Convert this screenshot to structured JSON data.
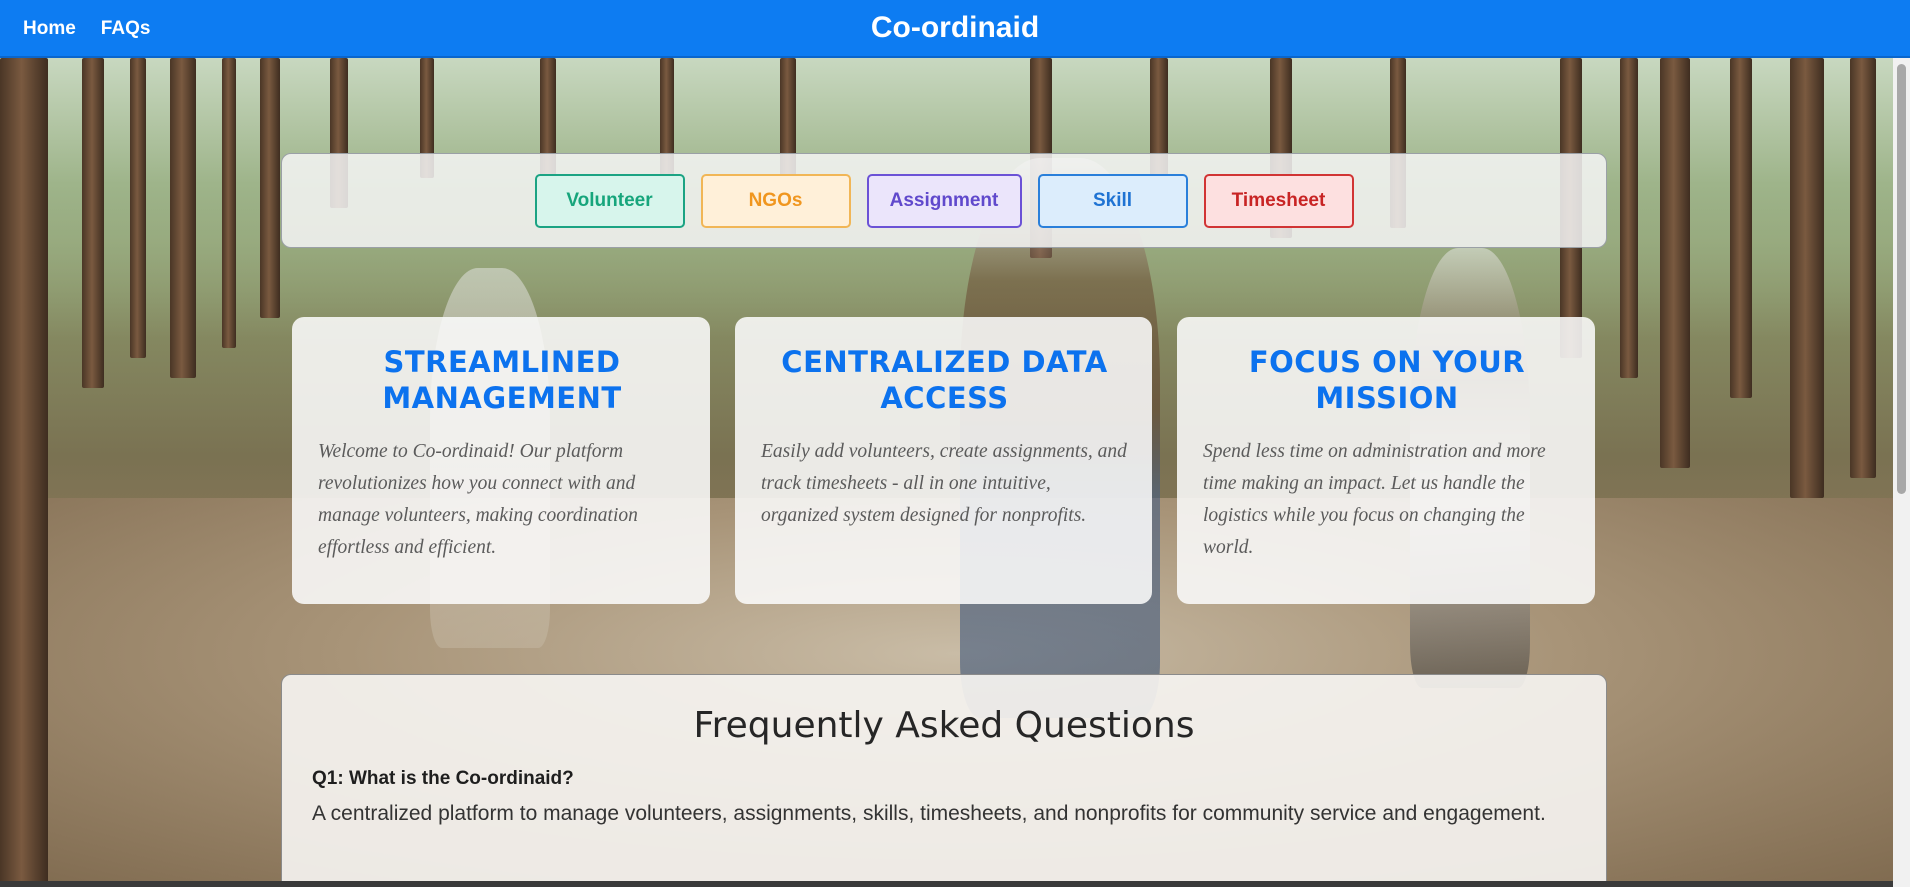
{
  "nav": {
    "brand": "Co-ordinaid",
    "links": [
      "Home",
      "FAQs"
    ]
  },
  "categories": [
    "Volunteer",
    "NGOs",
    "Assignment",
    "Skill",
    "Timesheet"
  ],
  "features": [
    {
      "title": "STREAMLINED MANAGEMENT",
      "text": "Welcome to Co-ordinaid! Our platform revolutionizes how you connect with and manage volunteers, making coordination effortless and efficient."
    },
    {
      "title": "CENTRALIZED DATA ACCESS",
      "text": "Easily add volunteers, create assignments, and track timesheets - all in one intuitive, organized system designed for nonprofits."
    },
    {
      "title": "FOCUS ON YOUR MISSION",
      "text": "Spend less time on administration and more time making an impact. Let us handle the logistics while you focus on changing the world."
    }
  ],
  "faq": {
    "heading": "Frequently Asked Questions",
    "items": [
      {
        "question": "Q1: What is the Co-ordinaid?",
        "answer": "A centralized platform to manage volunteers, assignments, skills, timesheets, and nonprofits for community service and engagement."
      }
    ]
  },
  "colors": {
    "navbar": "#0d7cf2",
    "card_title": "#0c72ee",
    "volunteer": "#17a57c",
    "ngos": "#f0961f",
    "assignment": "#6049cc",
    "skill": "#1f73d3",
    "timesheet": "#c82424"
  }
}
